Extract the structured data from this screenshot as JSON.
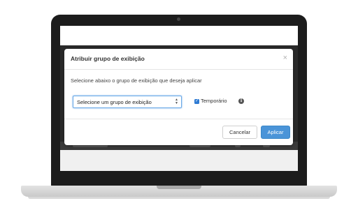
{
  "modal": {
    "title": "Atribuir grupo de exibição",
    "close_symbol": "×",
    "description": "Selecione abaixo o grupo de exibição que deseja aplicar",
    "select": {
      "value": "Selecione um grupo de exibição"
    },
    "temporary": {
      "label": "Temporário",
      "checked": true
    },
    "buttons": {
      "cancel": "Cancelar",
      "apply": "Aplicar"
    }
  },
  "colors": {
    "apply_button": "#4a94d8",
    "checkbox": "#2f7bd3",
    "laptop_frame": "#1c1c1c"
  },
  "icons": {
    "close": "close-icon",
    "select_arrows": "updown-arrows-icon",
    "info": "info-icon",
    "check": "check-icon"
  }
}
